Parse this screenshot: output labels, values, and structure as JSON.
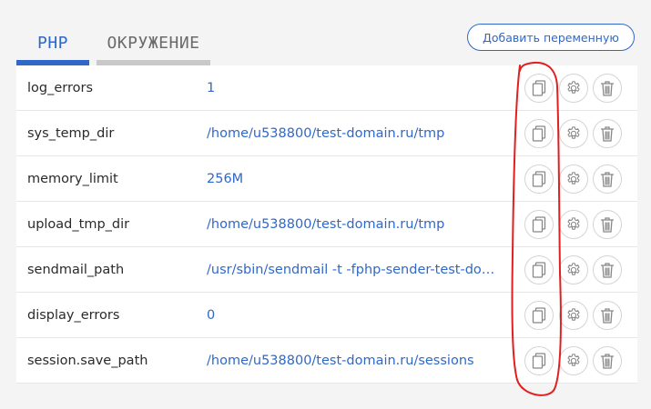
{
  "tabs": [
    {
      "label": "PHP",
      "active": true
    },
    {
      "label": "ОКРУЖЕНИЕ",
      "active": false
    }
  ],
  "add_button_label": "Добавить переменную",
  "rows": [
    {
      "name": "log_errors",
      "value": "1"
    },
    {
      "name": "sys_temp_dir",
      "value": "/home/u538800/test-domain.ru/tmp"
    },
    {
      "name": "memory_limit",
      "value": "256M"
    },
    {
      "name": "upload_tmp_dir",
      "value": "/home/u538800/test-domain.ru/tmp"
    },
    {
      "name": "sendmail_path",
      "value": "/usr/sbin/sendmail -t -fphp-sender-test-domain.ru"
    },
    {
      "name": "display_errors",
      "value": "0"
    },
    {
      "name": "session.save_path",
      "value": "/home/u538800/test-domain.ru/sessions"
    }
  ],
  "row_actions": [
    "copy-icon",
    "gear-icon",
    "trash-icon"
  ],
  "colors": {
    "accent": "#2f68c8",
    "inactive_tab": "#c9c9c9",
    "annotation": "#e02020"
  }
}
